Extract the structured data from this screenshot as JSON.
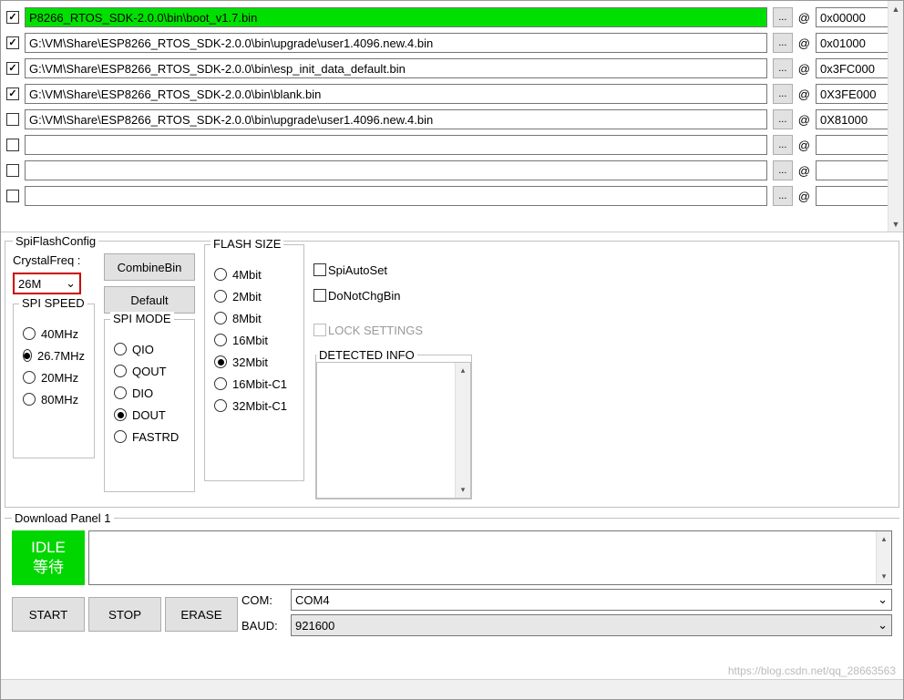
{
  "path_rows": [
    {
      "checked": true,
      "highlight": true,
      "path": "P8266_RTOS_SDK-2.0.0\\bin\\boot_v1.7.bin",
      "addr": "0x00000"
    },
    {
      "checked": true,
      "highlight": false,
      "path": "G:\\VM\\Share\\ESP8266_RTOS_SDK-2.0.0\\bin\\upgrade\\user1.4096.new.4.bin",
      "addr": "0x01000"
    },
    {
      "checked": true,
      "highlight": false,
      "path": "G:\\VM\\Share\\ESP8266_RTOS_SDK-2.0.0\\bin\\esp_init_data_default.bin",
      "addr": "0x3FC000"
    },
    {
      "checked": true,
      "highlight": false,
      "path": "G:\\VM\\Share\\ESP8266_RTOS_SDK-2.0.0\\bin\\blank.bin",
      "addr": "0X3FE000"
    },
    {
      "checked": false,
      "highlight": false,
      "path": "G:\\VM\\Share\\ESP8266_RTOS_SDK-2.0.0\\bin\\upgrade\\user1.4096.new.4.bin",
      "addr": "0X81000"
    },
    {
      "checked": false,
      "highlight": false,
      "path": "",
      "addr": ""
    },
    {
      "checked": false,
      "highlight": false,
      "path": "",
      "addr": ""
    },
    {
      "checked": false,
      "highlight": false,
      "path": "",
      "addr": ""
    }
  ],
  "browse_label": "...",
  "at_label": "@",
  "spi_section": "SpiFlashConfig",
  "crystal_label": "CrystalFreq :",
  "crystal_value": "26M",
  "buttons": {
    "combine": "CombineBin",
    "default": "Default"
  },
  "spi_speed": {
    "title": "SPI SPEED",
    "opts": [
      "40MHz",
      "26.7MHz",
      "20MHz",
      "80MHz"
    ],
    "selected": "26.7MHz"
  },
  "spi_mode": {
    "title": "SPI MODE",
    "opts": [
      "QIO",
      "QOUT",
      "DIO",
      "DOUT",
      "FASTRD"
    ],
    "selected": "DOUT"
  },
  "flash_size": {
    "title": "FLASH SIZE",
    "opts": [
      "4Mbit",
      "2Mbit",
      "8Mbit",
      "16Mbit",
      "32Mbit",
      "16Mbit-C1",
      "32Mbit-C1"
    ],
    "selected": "32Mbit"
  },
  "checks": {
    "spi_auto": "SpiAutoSet",
    "dont_chg": "DoNotChgBin",
    "lock": "LOCK SETTINGS"
  },
  "detected_label": "DETECTED INFO",
  "download_panel_label": "Download Panel 1",
  "idle": {
    "line1": "IDLE",
    "line2": "等待"
  },
  "dl_buttons": {
    "start": "START",
    "stop": "STOP",
    "erase": "ERASE"
  },
  "com_label": "COM:",
  "baud_label": "BAUD:",
  "com_value": "COM4",
  "baud_value": "921600",
  "watermark": "https://blog.csdn.net/qq_28663563"
}
